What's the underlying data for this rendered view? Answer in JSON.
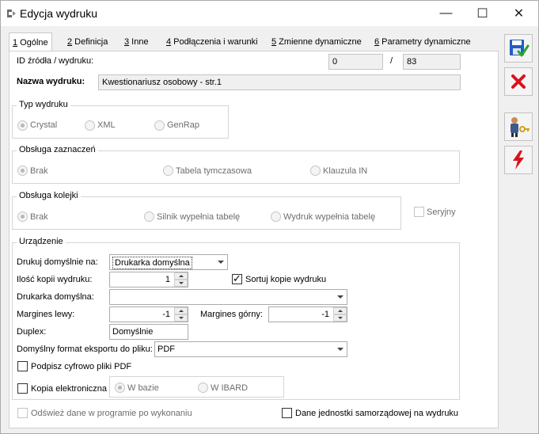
{
  "window": {
    "title": "Edycja wydruku",
    "controls": {
      "minimize": "—",
      "maximize": "☐",
      "close": "✕"
    }
  },
  "tabs": [
    {
      "key": "1",
      "rest": " Ogólne",
      "active": true
    },
    {
      "key": "2",
      "rest": " Definicja"
    },
    {
      "key": "3",
      "rest": " Inne"
    },
    {
      "key": "4",
      "rest": " Podłączenia i warunki"
    },
    {
      "key": "5",
      "rest": " Zmienne dynamiczne"
    },
    {
      "key": "6",
      "rest": " Parametry dynamiczne"
    }
  ],
  "general": {
    "id_label": "ID źródła / wydruku:",
    "source_id": "0",
    "separator": "/",
    "print_id": "83",
    "name_label": "Nazwa wydruku:",
    "name_value": "Kwestionariusz osobowy - str.1"
  },
  "print_type": {
    "title": "Typ wydruku",
    "options": [
      "Crystal",
      "XML",
      "GenRap"
    ],
    "selected": "Crystal"
  },
  "selection_handling": {
    "title": "Obsługa zaznaczeń",
    "options": [
      "Brak",
      "Tabela tymczasowa",
      "Klauzula IN"
    ],
    "selected": "Brak"
  },
  "queue_handling": {
    "title": "Obsługa kolejki",
    "options": [
      "Brak",
      "Silnik wypełnia tabelę",
      "Wydruk wypełnia tabelę"
    ],
    "selected": "Brak",
    "serial_label": "Seryjny"
  },
  "device": {
    "title": "Urządzenie",
    "default_print_label": "Drukuj domyślnie na:",
    "default_print_value": "Drukarka domyślna",
    "copies_label": "Ilość kopii wydruku:",
    "copies_value": "1",
    "sort_label": "Sortuj kopie wydruku",
    "sort_checked": true,
    "default_printer_label": "Drukarka domyślna:",
    "default_printer_value": "",
    "margin_left_label": "Margines lewy:",
    "margin_left_value": "-1",
    "margin_top_label": "Margines górny:",
    "margin_top_value": "-1",
    "duplex_label": "Duplex:",
    "duplex_value": "Domyślnie",
    "export_format_label": "Domyślny format eksportu do pliku:",
    "export_format_value": "PDF",
    "sign_pdf_label": "Podpisz cyfrowo pliki PDF",
    "e_copy_label": "Kopia elektroniczna",
    "e_copy_options": [
      "W bazie",
      "W IBARD"
    ],
    "e_copy_selected": "W bazie"
  },
  "footer": {
    "refresh_label": "Odśwież dane w programie po wykonaniu",
    "local_gov_label": "Dane jednostki samorządowej na wydruku"
  },
  "side_buttons": [
    {
      "name": "save-button",
      "icon": "save-icon"
    },
    {
      "name": "cancel-button",
      "icon": "red-x-icon"
    },
    {
      "name": "operators-button",
      "icon": "user-key-icon"
    },
    {
      "name": "execute-button",
      "icon": "lightning-icon"
    }
  ],
  "colors": {
    "accent_blue": "#1f5fbf",
    "cancel_red": "#d8131b",
    "save_green": "#2aa52a"
  }
}
